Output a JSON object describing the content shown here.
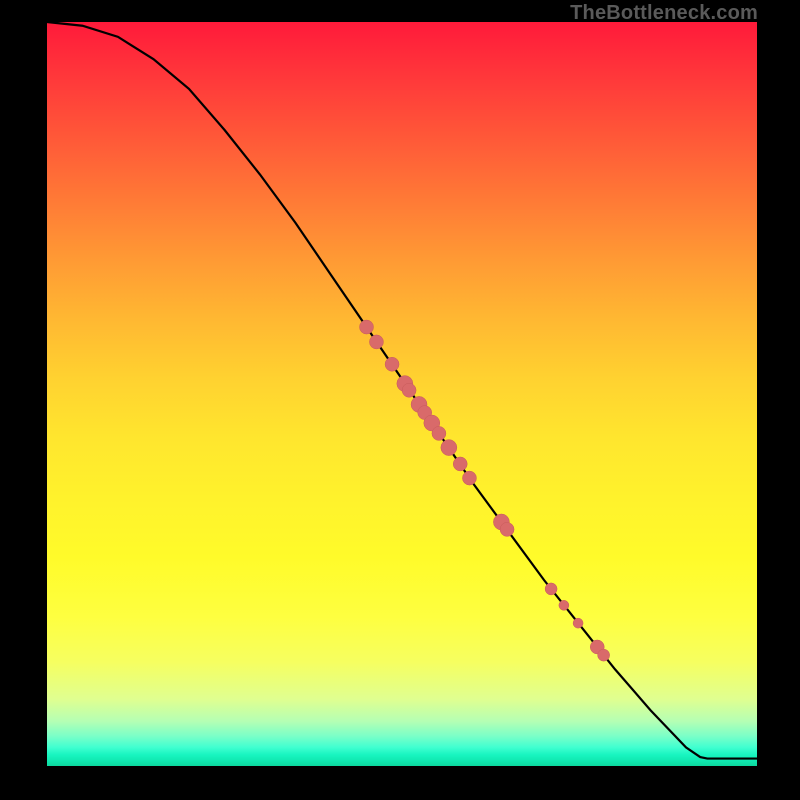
{
  "watermark": "TheBottleneck.com",
  "colors": {
    "point_fill": "#d96a6a",
    "point_stroke": "#c85b5b",
    "curve": "#000000"
  },
  "chart_data": {
    "type": "line",
    "title": "",
    "xlabel": "",
    "ylabel": "",
    "xlim": [
      0,
      100
    ],
    "ylim": [
      0,
      100
    ],
    "grid": false,
    "legend": false,
    "note": "No axes, ticks, or numeric labels are rendered in the source image; values below are estimated as percentages of the plot extent.",
    "curve": [
      {
        "x": 0,
        "y": 100
      },
      {
        "x": 5,
        "y": 99.5
      },
      {
        "x": 10,
        "y": 98
      },
      {
        "x": 15,
        "y": 95
      },
      {
        "x": 20,
        "y": 91
      },
      {
        "x": 25,
        "y": 85.5
      },
      {
        "x": 30,
        "y": 79.5
      },
      {
        "x": 35,
        "y": 73
      },
      {
        "x": 40,
        "y": 66
      },
      {
        "x": 45,
        "y": 59
      },
      {
        "x": 50,
        "y": 52
      },
      {
        "x": 55,
        "y": 45
      },
      {
        "x": 60,
        "y": 38
      },
      {
        "x": 65,
        "y": 31.5
      },
      {
        "x": 70,
        "y": 25
      },
      {
        "x": 75,
        "y": 19
      },
      {
        "x": 80,
        "y": 13
      },
      {
        "x": 85,
        "y": 7.5
      },
      {
        "x": 90,
        "y": 2.5
      },
      {
        "x": 92,
        "y": 1.2
      },
      {
        "x": 93,
        "y": 1.0
      },
      {
        "x": 100,
        "y": 1.0
      }
    ],
    "points": [
      {
        "x": 45.0,
        "y": 59.0,
        "r": 7
      },
      {
        "x": 46.4,
        "y": 57.0,
        "r": 7
      },
      {
        "x": 48.6,
        "y": 54.0,
        "r": 7
      },
      {
        "x": 50.4,
        "y": 51.4,
        "r": 8
      },
      {
        "x": 51.0,
        "y": 50.5,
        "r": 7
      },
      {
        "x": 52.4,
        "y": 48.6,
        "r": 8
      },
      {
        "x": 53.2,
        "y": 47.5,
        "r": 7
      },
      {
        "x": 54.2,
        "y": 46.1,
        "r": 8
      },
      {
        "x": 55.2,
        "y": 44.7,
        "r": 7
      },
      {
        "x": 56.6,
        "y": 42.8,
        "r": 8
      },
      {
        "x": 58.2,
        "y": 40.6,
        "r": 7
      },
      {
        "x": 59.5,
        "y": 38.7,
        "r": 7
      },
      {
        "x": 64.0,
        "y": 32.8,
        "r": 8
      },
      {
        "x": 64.8,
        "y": 31.8,
        "r": 7
      },
      {
        "x": 71.0,
        "y": 23.8,
        "r": 6
      },
      {
        "x": 72.8,
        "y": 21.6,
        "r": 5
      },
      {
        "x": 74.8,
        "y": 19.2,
        "r": 5
      },
      {
        "x": 77.5,
        "y": 16.0,
        "r": 7
      },
      {
        "x": 78.4,
        "y": 14.9,
        "r": 6
      }
    ]
  }
}
